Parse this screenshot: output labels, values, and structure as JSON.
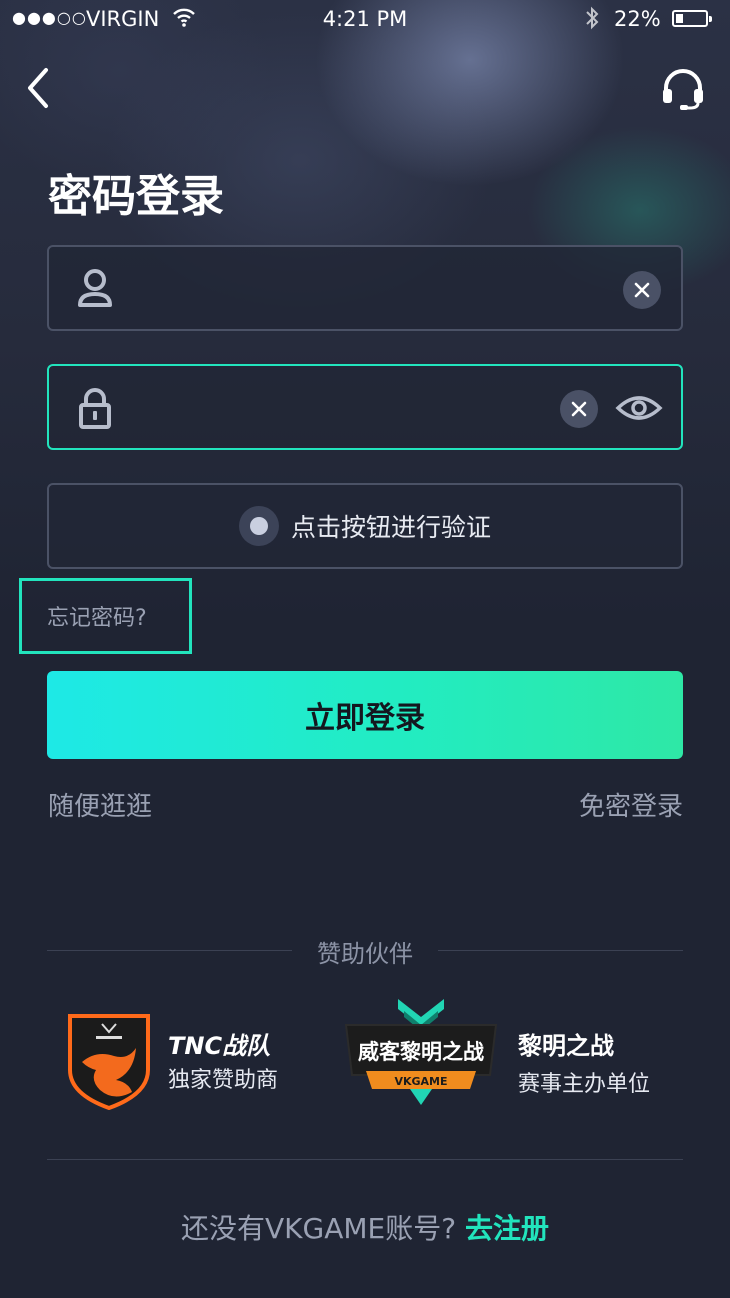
{
  "status_bar": {
    "signal": "●●●○○",
    "carrier": "VIRGIN",
    "time": "4:21 PM",
    "battery": "22%"
  },
  "header": {
    "back_icon": "chevron-left-icon",
    "support_icon": "headset-icon"
  },
  "page_title": "密码登录",
  "form": {
    "username": {
      "value": "",
      "placeholder": "",
      "icon": "user-icon"
    },
    "password": {
      "value": "",
      "placeholder": "",
      "icon": "lock-icon"
    },
    "verify_label": "点击按钮进行验证",
    "forgot_label": "忘记密码?",
    "login_label": "立即登录"
  },
  "secondary_links": {
    "browse": "随便逛逛",
    "passwordless": "免密登录"
  },
  "sponsors": {
    "title": "赞助伙伴",
    "items": [
      {
        "name": "TNC战队",
        "role": "独家赞助商"
      },
      {
        "name": "黎明之战",
        "role": "赛事主办单位",
        "logo_text": "威客黎明之战",
        "logo_ribbon": "VKGAME"
      }
    ]
  },
  "register": {
    "prompt": "还没有VKGAME账号?",
    "link": "去注册"
  },
  "colors": {
    "accent": "#22e4bd",
    "background": "#1f2433",
    "button_gradient_start": "#1ee9e6",
    "button_gradient_end": "#2ee8a6"
  }
}
